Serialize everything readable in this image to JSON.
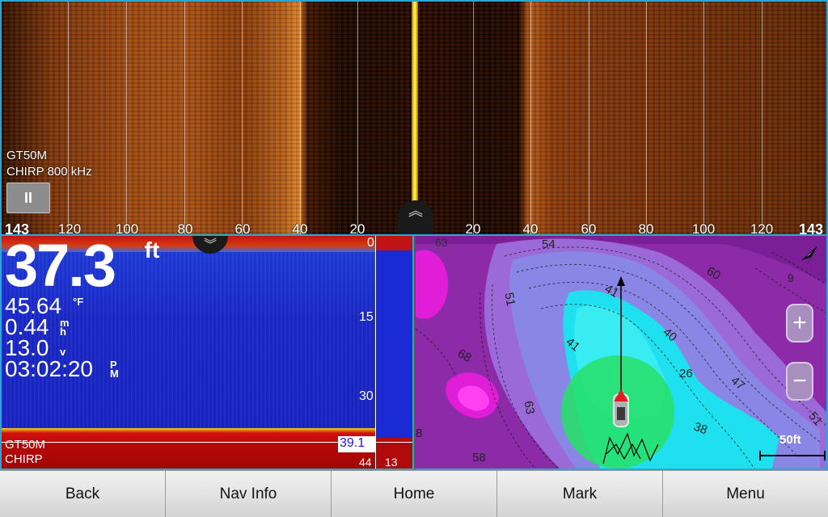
{
  "sidevu": {
    "source_line1": "GT50M",
    "source_line2": "CHIRP 800 kHz",
    "pause_label": "II",
    "range_left": "143",
    "range_right": "143",
    "scale_labels": [
      "120",
      "100",
      "80",
      "60",
      "40",
      "20",
      "0",
      "20",
      "40",
      "60",
      "80",
      "100",
      "120"
    ],
    "collapse_icon": "chevron-double-up-icon"
  },
  "sonar": {
    "depth_value": "37.3",
    "depth_unit": "ft",
    "temperature_value": "45.64",
    "temperature_unit": "°F",
    "speed_value": "0.44",
    "speed_unit": "mh",
    "voltage_value": "13.0",
    "voltage_unit": "v",
    "time_value": "03:02:20",
    "time_suffix": "PM",
    "depth_scale": [
      "0",
      "15",
      "30"
    ],
    "source_line1": "GT50M",
    "source_line2": "CHIRP",
    "bottom_depth_box": "39.1",
    "flasher_depth": "44",
    "flasher_extra": "13",
    "collapse_icon": "chevron-double-down-icon"
  },
  "chart": {
    "contour_labels": [
      "63",
      "54",
      "60",
      "9",
      "51",
      "41",
      "41",
      "40",
      "26",
      "47",
      "68",
      "63",
      "38",
      "51",
      "8",
      "58"
    ],
    "zoom_in_label": "+",
    "zoom_out_label": "−",
    "scale_label": "50ft",
    "north_icon": "north-arrow-icon",
    "vessel_icon": "boat-icon"
  },
  "bottom_bar": {
    "buttons": [
      "Back",
      "Nav Info",
      "Home",
      "Mark",
      "Menu"
    ]
  }
}
